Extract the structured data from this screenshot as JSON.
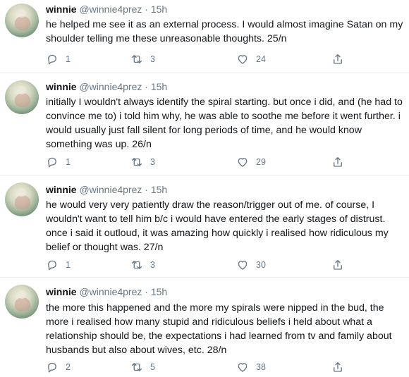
{
  "tweets": [
    {
      "name": "winnie",
      "handle": "@winnie4prez",
      "dot": "·",
      "time": "15h",
      "text": "he helped me see it as an external process. I would almost imagine Satan on my shoulder telling me these unreasonable thoughts. 25/n",
      "replies": "1",
      "retweets": "3",
      "likes": "24"
    },
    {
      "name": "winnie",
      "handle": "@winnie4prez",
      "dot": "·",
      "time": "15h",
      "text": "initially I wouldn't always identify the spiral starting. but once i did, and (he had to convince me to) i told him why, he was able to soothe me before it went further. i would usually just fall silent for long periods of time, and he would know something was up. 26/n",
      "replies": "1",
      "retweets": "3",
      "likes": "29"
    },
    {
      "name": "winnie",
      "handle": "@winnie4prez",
      "dot": "·",
      "time": "15h",
      "text": "he would very very patiently draw the reason/trigger out of me. of course, I wouldn't want to tell him b/c i would have entered the early stages of distrust. once i said it outloud, it was amazing how quickly i realised how ridiculous my belief or thought was. 27/n",
      "replies": "1",
      "retweets": "3",
      "likes": "30"
    },
    {
      "name": "winnie",
      "handle": "@winnie4prez",
      "dot": "·",
      "time": "15h",
      "text": "the more this happened and the more my spirals were nipped in the bud, the more i realised how many stupid and ridiculous beliefs i held about what a relationship should be, the expectations i had learned from tv and family about husbands but also about wives, etc. 28/n",
      "replies": "2",
      "retweets": "5",
      "likes": "38"
    }
  ],
  "icons": [
    "reply-icon",
    "retweet-icon",
    "like-icon",
    "share-icon"
  ],
  "colors": {
    "text": "#14171a",
    "secondary": "#657786",
    "divider": "#e6ecf0"
  }
}
